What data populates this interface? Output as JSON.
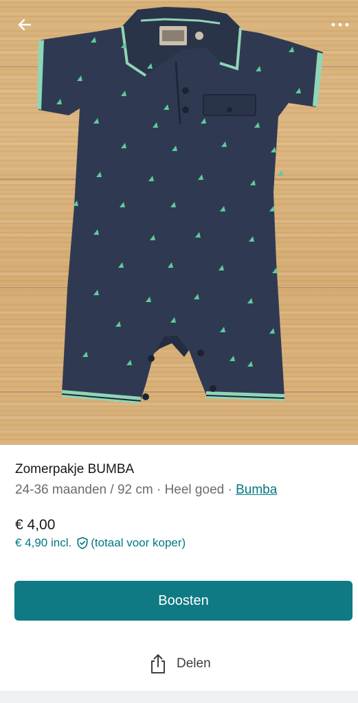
{
  "photo": {
    "alt": "",
    "back_icon": "arrow-left-icon",
    "more_icon": "more-horizontal-icon"
  },
  "listing": {
    "title": "Zomerpakje BUMBA",
    "size": "24-36 maanden / 92 cm",
    "separator1": " · ",
    "condition": "Heel goed",
    "separator2": " · ",
    "brand": "Bumba",
    "price": "€ 4,00",
    "price_incl": "€ 4,90 incl.",
    "price_incl_note": "(totaal voor koper)",
    "shield_icon": "shield-check-icon"
  },
  "actions": {
    "boost_label": "Boosten",
    "share_label": "Delen",
    "share_icon": "share-icon"
  },
  "colors": {
    "accent": "#007782",
    "button": "#0f7a84",
    "garment": "#2f3a52",
    "pattern": "#5ecb9c"
  }
}
